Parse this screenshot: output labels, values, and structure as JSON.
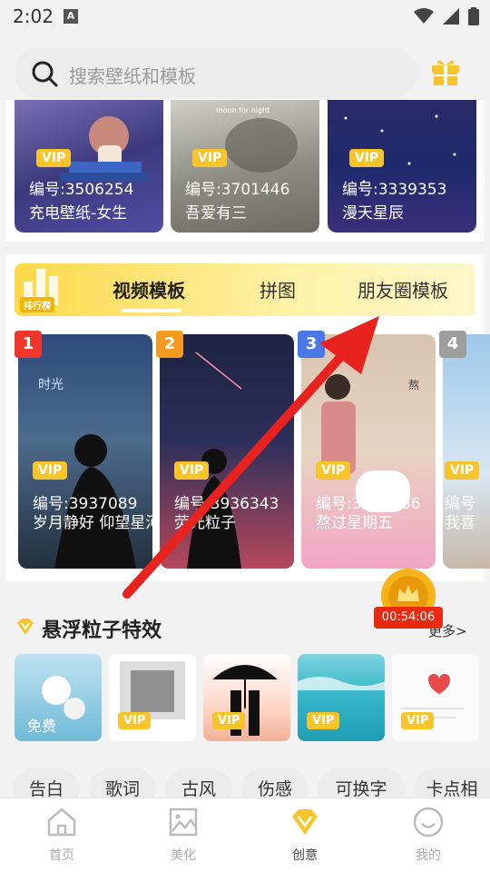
{
  "status_bar": {
    "time": "2:02"
  },
  "search": {
    "placeholder": "搜索壁纸和模板"
  },
  "top_row": [
    {
      "vip": "VIP",
      "code": "编号:3506254",
      "name": "充电壁纸-女生"
    },
    {
      "vip": "VIP",
      "code": "编号:3701446",
      "name": "吾爱有三"
    },
    {
      "vip": "VIP",
      "code": "编号:3339353",
      "name": "漫天星辰"
    }
  ],
  "ranking": {
    "badge_label": "排行榜",
    "tabs": [
      {
        "label": "视频模板",
        "active": true
      },
      {
        "label": "拼图",
        "active": false
      },
      {
        "label": "朋友圈模板",
        "active": false
      }
    ],
    "items": [
      {
        "rank": "1",
        "rank_color": "#f0362a",
        "vip": "VIP",
        "code": "编号:3937089",
        "name": "岁月静好 仰望星河"
      },
      {
        "rank": "2",
        "rank_color": "#f59a20",
        "vip": "VIP",
        "code": "编号:3936343",
        "name": "荧光粒子"
      },
      {
        "rank": "3",
        "rank_color": "#4a78e8",
        "vip": "VIP",
        "code": "编号:3935266",
        "name": "熬过星期五"
      },
      {
        "rank": "4",
        "rank_color": "#9e9e9e",
        "vip": "VIP",
        "code": "编号",
        "name": "我喜"
      }
    ]
  },
  "particle": {
    "title": "悬浮粒子特效",
    "more": "更多>",
    "tiles": [
      {
        "badge": "免费"
      },
      {
        "badge": "VIP"
      },
      {
        "badge": "VIP"
      },
      {
        "badge": "VIP"
      },
      {
        "badge": "VIP"
      }
    ]
  },
  "chips": [
    "告白",
    "歌词",
    "古风",
    "伤感",
    "可换字",
    "卡点相"
  ],
  "floating": {
    "timer": "00:54:06"
  },
  "nav": [
    {
      "label": "首页",
      "icon": "home-icon",
      "active": false
    },
    {
      "label": "美化",
      "icon": "image-icon",
      "active": false
    },
    {
      "label": "创意",
      "icon": "diamond-icon",
      "active": true
    },
    {
      "label": "我的",
      "icon": "smile-icon",
      "active": false
    }
  ],
  "colors": {
    "accent": "#f7c52b",
    "red_arrow": "#e8231f"
  }
}
